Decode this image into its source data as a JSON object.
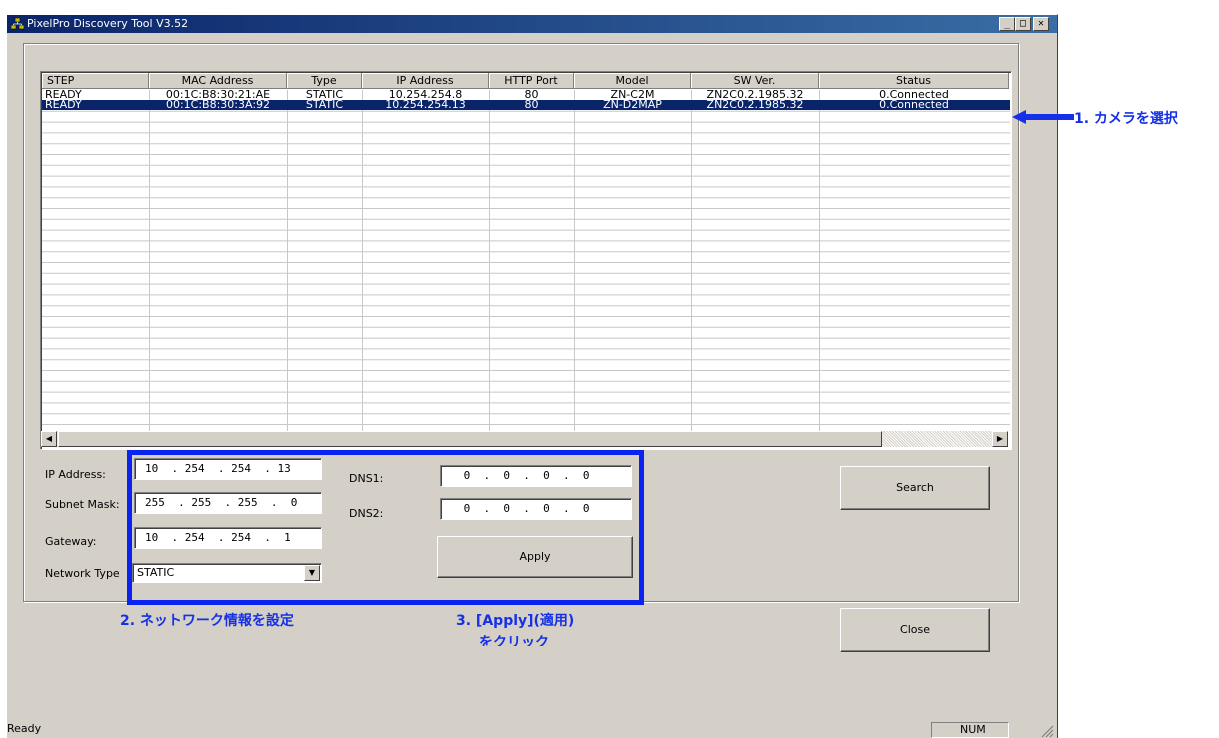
{
  "window": {
    "title": "PixelPro Discovery Tool V3.52",
    "min": "_",
    "max": "□",
    "close": "✕"
  },
  "table": {
    "columns": [
      "STEP",
      "MAC Address",
      "Type",
      "IP Address",
      "HTTP Port",
      "Model",
      "SW Ver.",
      "Status"
    ],
    "rows": [
      [
        "READY",
        "00:1C:B8:30:21:AE",
        "STATIC",
        "10.254.254.8",
        "80",
        "ZN-C2M",
        "ZN2C0.2.1985.32",
        "0.Connected"
      ],
      [
        "READY",
        "00:1C:B8:30:3A:92",
        "STATIC",
        "10.254.254.13",
        "80",
        "ZN-D2MAP",
        "ZN2C0.2.1985.32",
        "0.Connected"
      ]
    ],
    "selected_row": 1
  },
  "form": {
    "ip_label": "IP Address:",
    "ip_value": "10  . 254  . 254  . 13",
    "subnet_label": "Subnet Mask:",
    "subnet_value": "255  . 255  . 255  .  0",
    "gateway_label": "Gateway:",
    "gateway_value": "10  . 254  . 254  .  1",
    "nettype_label": "Network Type",
    "nettype_value": "STATIC",
    "dns1_label": "DNS1:",
    "dns1_value": " 0  .  0  .  0  .  0",
    "dns2_label": "DNS2:",
    "dns2_value": " 0  .  0  .  0  .  0"
  },
  "buttons": {
    "apply": "Apply",
    "search": "Search",
    "close": "Close"
  },
  "annotations": {
    "step1": "1. カメラを選択",
    "step2": "2. ネットワーク情報を設定",
    "step3_line1": "3. [Apply](適用)",
    "step3_line2": "をクリック"
  },
  "statusbar": {
    "text": "Ready",
    "num": "NUM"
  },
  "colors": {
    "titlebar": "#0a246a",
    "selection": "#0a246a",
    "annotation": "#1530e6",
    "window_bg": "#d4d0c8"
  }
}
